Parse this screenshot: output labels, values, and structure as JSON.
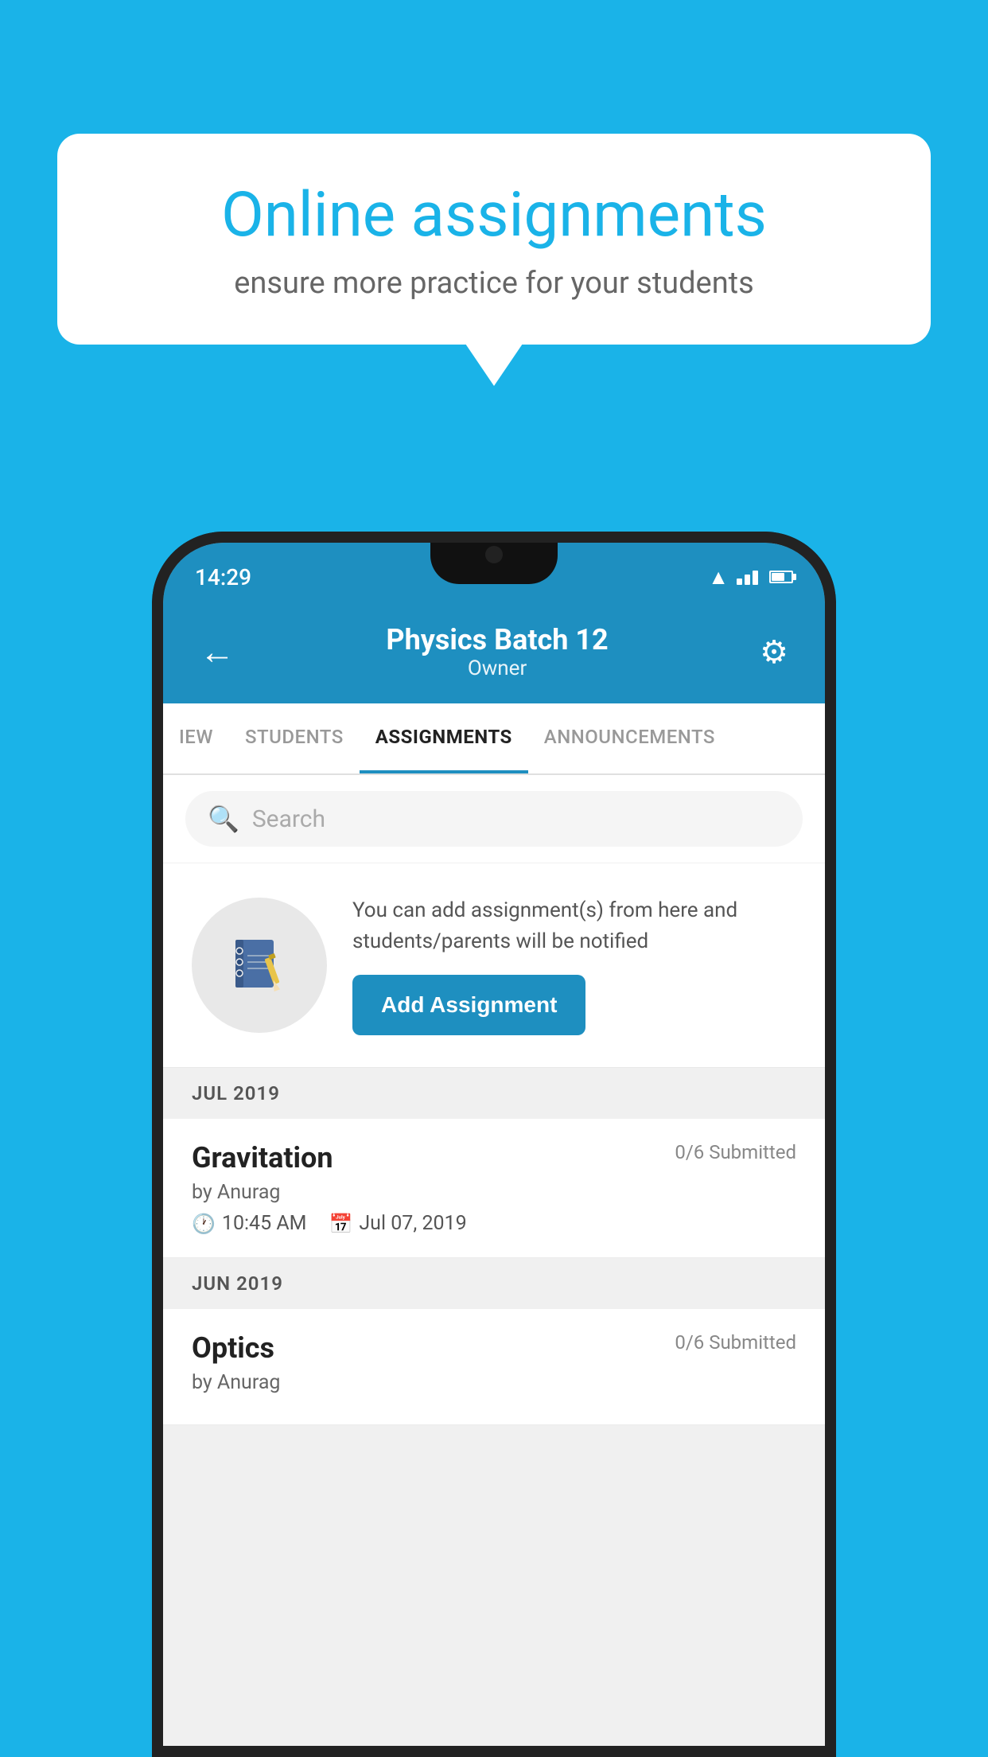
{
  "background_color": "#1ab3e8",
  "speech_bubble": {
    "title": "Online assignments",
    "subtitle": "ensure more practice for your students"
  },
  "status_bar": {
    "time": "14:29",
    "wifi": true,
    "signal": true,
    "battery": true
  },
  "app_header": {
    "title": "Physics Batch 12",
    "subtitle": "Owner",
    "back_label": "←",
    "settings_label": "⚙"
  },
  "tabs": [
    {
      "label": "IEW",
      "active": false
    },
    {
      "label": "STUDENTS",
      "active": false
    },
    {
      "label": "ASSIGNMENTS",
      "active": true
    },
    {
      "label": "ANNOUNCEMENTS",
      "active": false
    }
  ],
  "search": {
    "placeholder": "Search"
  },
  "promo_card": {
    "text": "You can add assignment(s) from here and students/parents will be notified",
    "button_label": "Add Assignment"
  },
  "sections": [
    {
      "header": "JUL 2019",
      "assignments": [
        {
          "title": "Gravitation",
          "submitted": "0/6 Submitted",
          "author": "by Anurag",
          "time": "10:45 AM",
          "date": "Jul 07, 2019"
        }
      ]
    },
    {
      "header": "JUN 2019",
      "assignments": [
        {
          "title": "Optics",
          "submitted": "0/6 Submitted",
          "author": "by Anurag",
          "time": "",
          "date": ""
        }
      ]
    }
  ]
}
